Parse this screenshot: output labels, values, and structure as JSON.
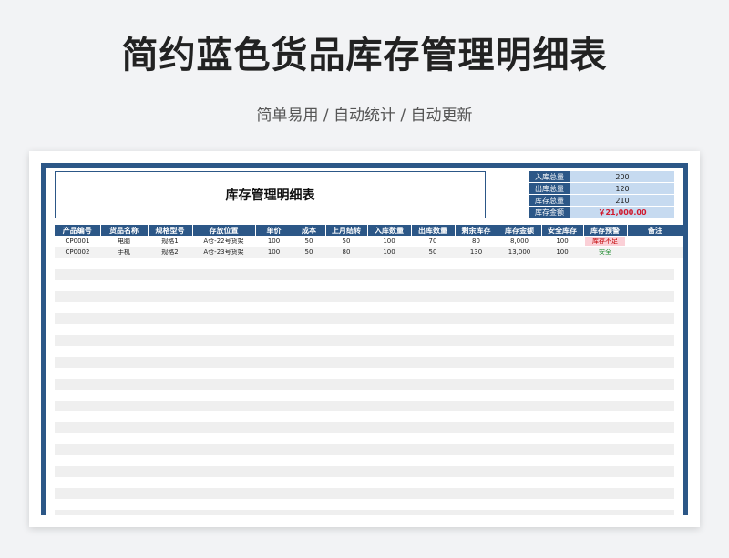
{
  "page": {
    "title": "简约蓝色货品库存管理明细表",
    "subtitle": "简单易用 / 自动统计 / 自动更新"
  },
  "sheet": {
    "title": "库存管理明细表",
    "summary": [
      {
        "label": "入库总量",
        "value": "200"
      },
      {
        "label": "出库总量",
        "value": "120"
      },
      {
        "label": "库存总量",
        "value": "210"
      },
      {
        "label": "库存金额",
        "value": "￥21,000.00"
      }
    ],
    "columns": [
      "产品编号",
      "货品名称",
      "规格型号",
      "存放位置",
      "单价",
      "成本",
      "上月结转",
      "入库数量",
      "出库数量",
      "剩余库存",
      "库存金额",
      "安全库存",
      "库存预警",
      "备注"
    ],
    "rows": [
      [
        "CP0001",
        "电脑",
        "规格1",
        "A仓-22号货架",
        "100",
        "50",
        "50",
        "100",
        "70",
        "80",
        "8,000",
        "100",
        "库存不足",
        ""
      ],
      [
        "CP0002",
        "手机",
        "规格2",
        "A仓-23号货架",
        "100",
        "50",
        "80",
        "100",
        "50",
        "130",
        "13,000",
        "100",
        "安全",
        ""
      ]
    ]
  },
  "colors": {
    "header_blue": "#2c5787",
    "summary_value_bg": "#c6daf0",
    "warning_red": "#c00000",
    "warning_bg": "#fbd0d7",
    "safe_green": "#1e8a2e",
    "money_red": "#d0182c"
  }
}
